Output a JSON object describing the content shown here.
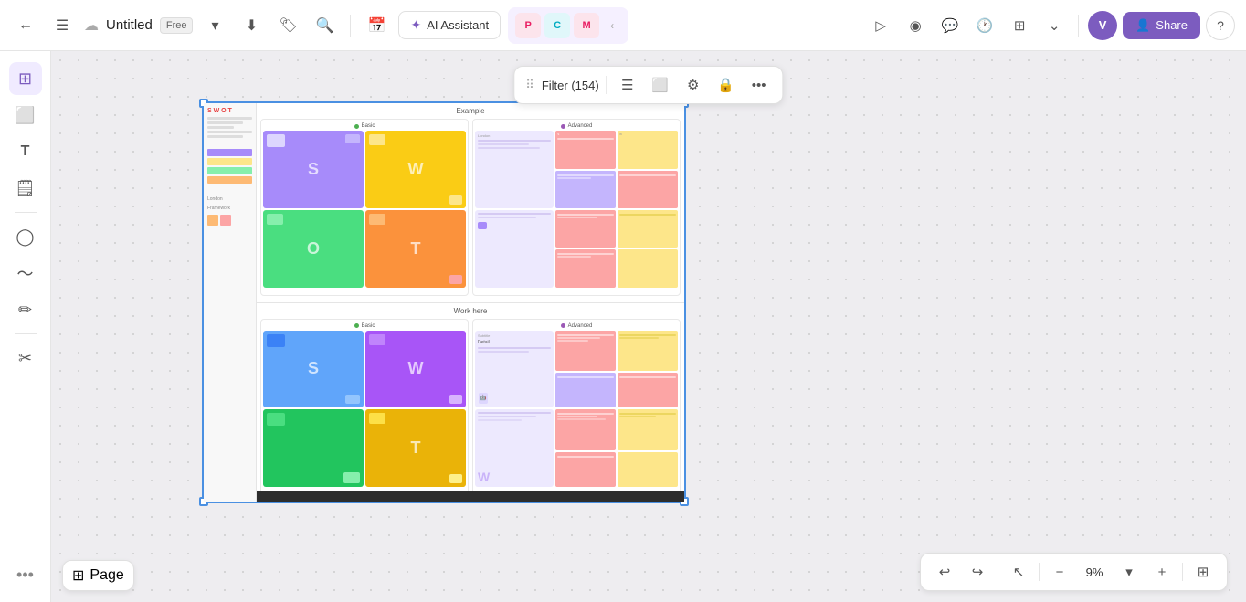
{
  "header": {
    "back_label": "←",
    "menu_label": "☰",
    "title": "Untitled",
    "badge": "Free",
    "download_icon": "⬇",
    "tag_icon": "🏷",
    "search_icon": "🔍",
    "ai_assistant_label": "AI Assistant",
    "apps": [
      {
        "id": "calendar",
        "color": "#ff6b6b",
        "label": "📅"
      },
      {
        "id": "p-app",
        "color": "#4a90e2",
        "label": "P"
      },
      {
        "id": "c-app",
        "color": "#50c878",
        "label": "C"
      },
      {
        "id": "m-app",
        "color": "#ff69b4",
        "label": "M"
      }
    ],
    "chevron_icon": "‹",
    "right_icons": [
      "▷",
      "◉",
      "💬",
      "🕐",
      "⊞",
      "⌄"
    ],
    "avatar_label": "V",
    "share_label": "Share",
    "share_icon": "👤",
    "help_icon": "?"
  },
  "sidebar": {
    "items": [
      {
        "id": "pages",
        "icon": "⊞",
        "label": "pages"
      },
      {
        "id": "frame",
        "icon": "⬜",
        "label": "frame"
      },
      {
        "id": "text",
        "icon": "T",
        "label": "text"
      },
      {
        "id": "sticky",
        "icon": "🗒",
        "label": "sticky"
      },
      {
        "id": "shapes",
        "icon": "◯",
        "label": "shapes"
      },
      {
        "id": "line",
        "icon": "〜",
        "label": "line"
      },
      {
        "id": "pen",
        "icon": "✏",
        "label": "pen"
      },
      {
        "id": "more",
        "icon": "✂",
        "label": "more"
      }
    ],
    "more_label": "•••"
  },
  "float_toolbar": {
    "grid_icon": "⠿",
    "filter_label": "Filter (154)",
    "align_icon": "☰",
    "frame_icon": "⬜",
    "link_icon": "⚙",
    "lock_icon": "🔒",
    "more_icon": "•••"
  },
  "canvas": {
    "sections": [
      {
        "id": "example",
        "title": "Example",
        "panels": [
          {
            "id": "basic",
            "label": "Basic",
            "dot_color": "#4caf50",
            "cells": [
              {
                "letter": "S",
                "color": "#a78bfa"
              },
              {
                "letter": "W",
                "color": "#facc15"
              },
              {
                "letter": "O",
                "color": "#4ade80"
              },
              {
                "letter": "T",
                "color": "#fb923c"
              }
            ]
          },
          {
            "id": "advanced",
            "label": "Advanced",
            "dot_color": "#9b59b6"
          }
        ]
      },
      {
        "id": "work-here",
        "title": "Work here",
        "panels": [
          {
            "id": "basic2",
            "label": "Basic",
            "dot_color": "#4caf50"
          },
          {
            "id": "advanced2",
            "label": "Advanced",
            "dot_color": "#9b59b6"
          }
        ]
      }
    ]
  },
  "bottom_toolbar": {
    "undo_icon": "↩",
    "redo_icon": "↪",
    "cursor_icon": "↖",
    "zoom_out_icon": "−",
    "zoom_value": "9%",
    "zoom_dropdown": "▾",
    "zoom_in_icon": "+",
    "grid_view_icon": "⊞"
  },
  "page_btn": {
    "icon": "⊞",
    "label": "Page"
  }
}
